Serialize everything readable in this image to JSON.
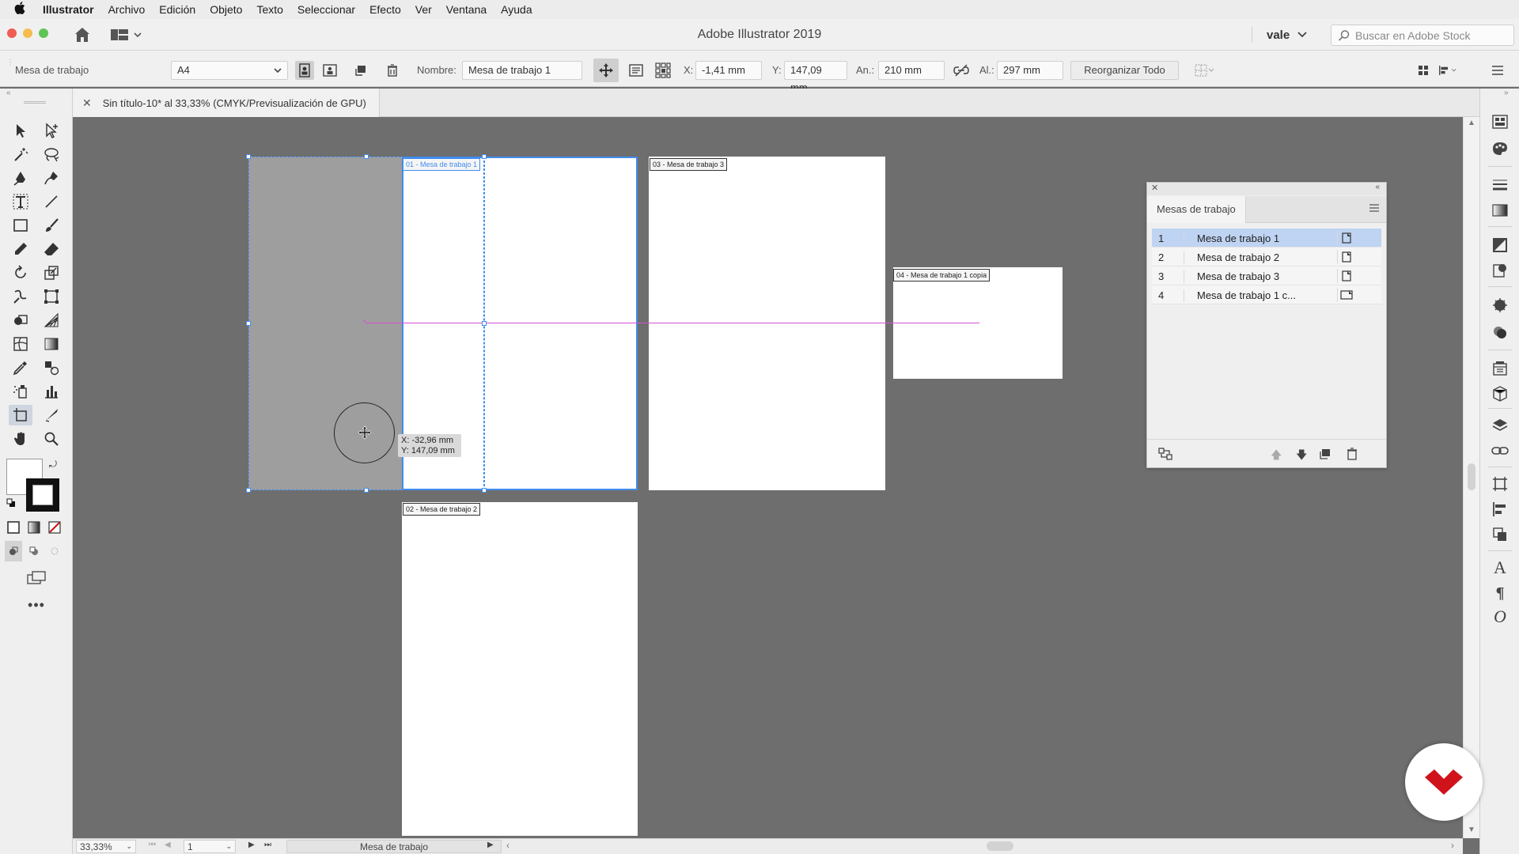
{
  "menubar": {
    "app_name": "Illustrator",
    "menus": [
      "Archivo",
      "Edición",
      "Objeto",
      "Texto",
      "Seleccionar",
      "Efecto",
      "Ver",
      "Ventana",
      "Ayuda"
    ]
  },
  "appbar": {
    "title": "Adobe Illustrator 2019",
    "user": "vale",
    "search_placeholder": "Buscar en Adobe Stock"
  },
  "controlbar": {
    "context_label": "Mesa de trabajo",
    "preset": "A4",
    "name_label": "Nombre:",
    "name_value": "Mesa de trabajo 1",
    "x_label": "X:",
    "x_value": "-1,41 mm",
    "y_label": "Y:",
    "y_value": "147,09 mm",
    "w_label": "An.:",
    "w_value": "210 mm",
    "h_label": "Al.:",
    "h_value": "297 mm",
    "rearrange_label": "Reorganizar Todo"
  },
  "document": {
    "tab_title": "Sin título-10* al 33,33% (CMYK/Previsualización de GPU)"
  },
  "canvas": {
    "artboard_labels": [
      "01 - Mesa de trabajo 1",
      "02 - Mesa de trabajo 2",
      "03 - Mesa de trabajo 3",
      "04 - Mesa de trabajo 1 copia"
    ],
    "cursor_readout_x": "X: -32,96 mm",
    "cursor_readout_y": "Y: 147,09 mm"
  },
  "artboards_panel": {
    "title": "Mesas de trabajo",
    "rows": [
      {
        "num": "1",
        "name": "Mesa de trabajo 1",
        "selected": true
      },
      {
        "num": "2",
        "name": "Mesa de trabajo 2",
        "selected": false
      },
      {
        "num": "3",
        "name": "Mesa de trabajo 3",
        "selected": false
      },
      {
        "num": "4",
        "name": "Mesa de trabajo 1 c...",
        "selected": false
      }
    ]
  },
  "statusbar": {
    "zoom": "33,33%",
    "page": "1",
    "tool_status": "Mesa de trabajo"
  },
  "colors": {
    "selection_blue": "#3f8df0",
    "guide_magenta": "#d64fd2",
    "canvas_gray": "#6e6e6e",
    "logo_red": "#d0121b"
  }
}
